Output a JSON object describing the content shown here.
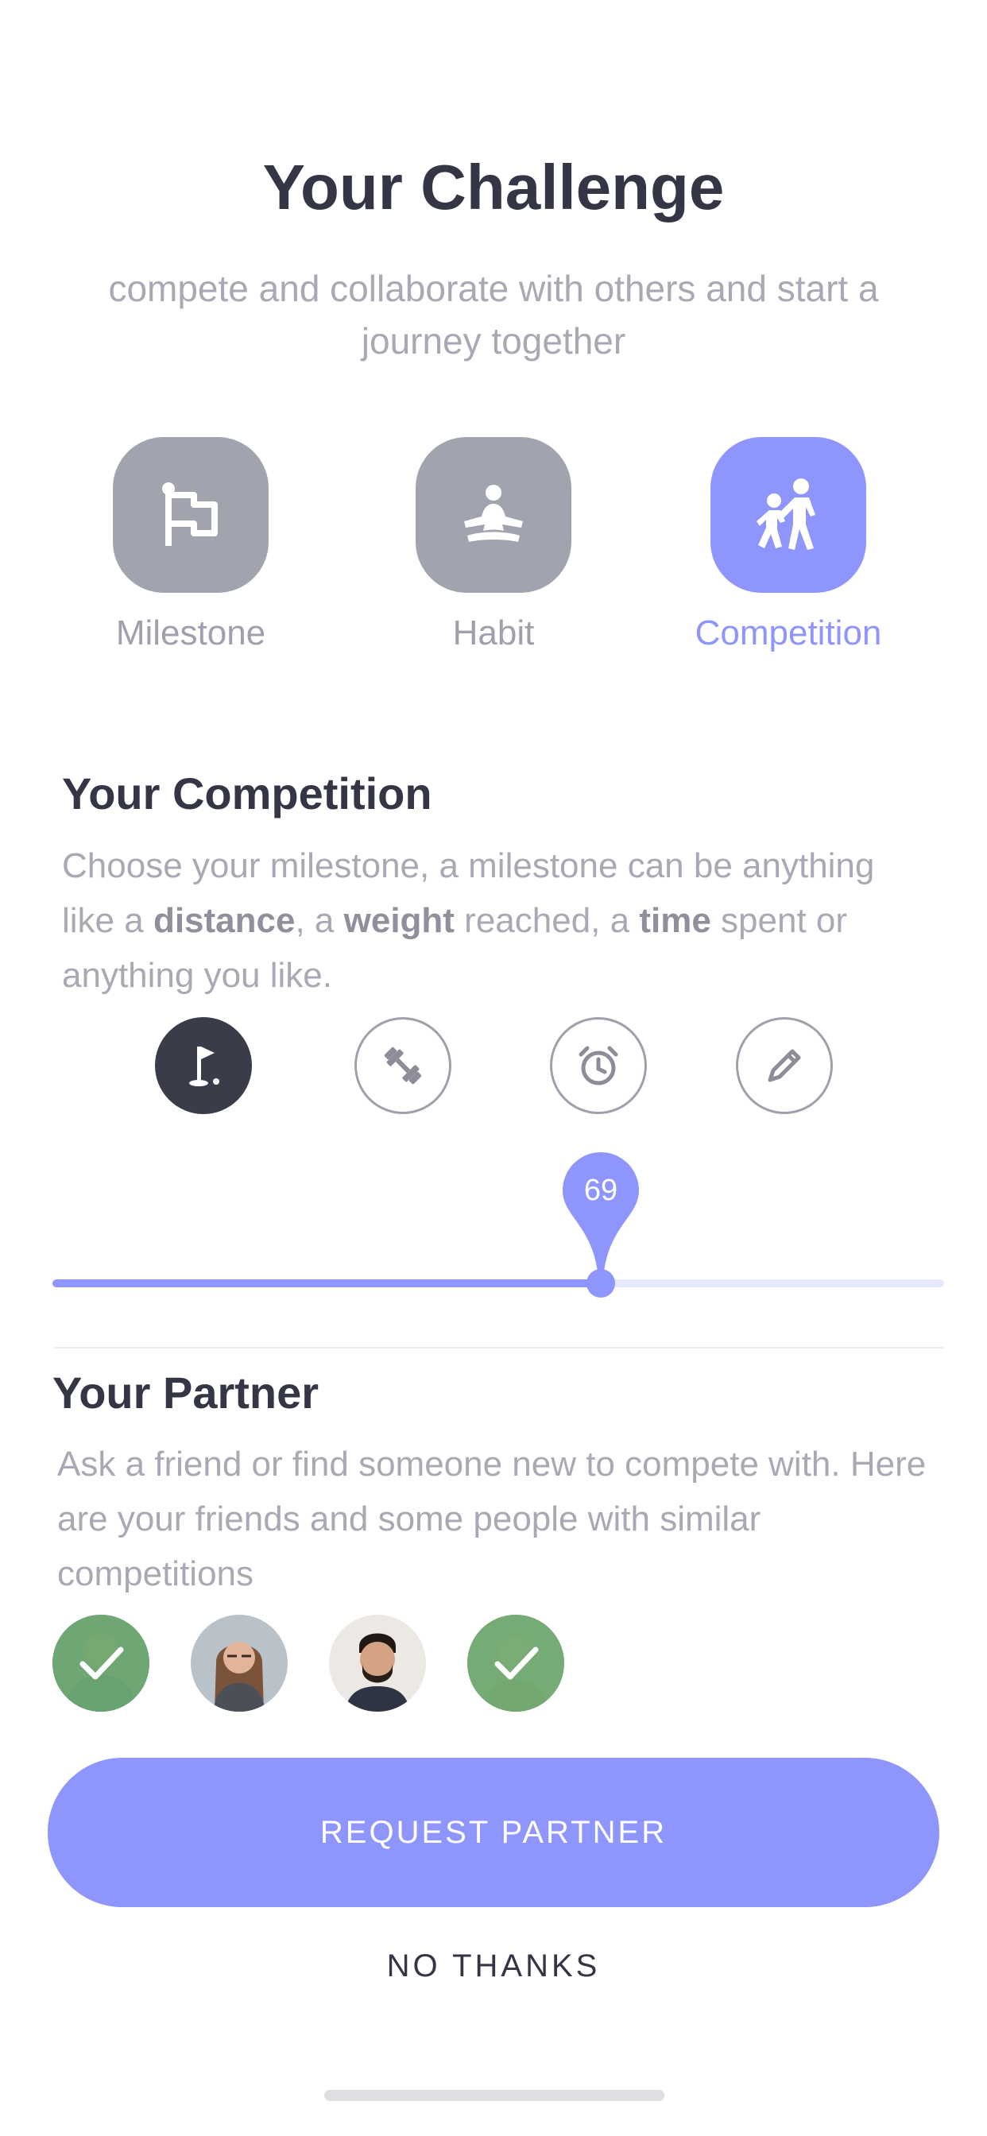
{
  "header": {
    "title": "Your Challenge",
    "subtitle": "compete and collaborate with others and start a journey together"
  },
  "challenge_types": [
    {
      "label": "Milestone",
      "icon": "flag-icon",
      "selected": false
    },
    {
      "label": "Habit",
      "icon": "meditation-icon",
      "selected": false
    },
    {
      "label": "Competition",
      "icon": "competition-people-icon",
      "selected": true
    }
  ],
  "competition": {
    "title": "Your Competition",
    "desc_1": "Choose your milestone, a milestone can be anything like a ",
    "bold_1": "distance",
    "desc_2": ", a ",
    "bold_2": "weight",
    "desc_3": " reached, a ",
    "bold_3": "time",
    "desc_4": " spent or anything you like.",
    "milestone_types": [
      {
        "icon": "golf-flag-icon",
        "selected": true
      },
      {
        "icon": "dumbbell-icon",
        "selected": false
      },
      {
        "icon": "alarm-clock-icon",
        "selected": false
      },
      {
        "icon": "pencil-icon",
        "selected": false
      }
    ],
    "slider": {
      "value": "69",
      "fraction": 0.615
    }
  },
  "partner": {
    "title": "Your Partner",
    "desc": "Ask a friend or find someone new to compete with. Here are your friends and some people with similar competitions",
    "avatars": [
      {
        "name": "partner-avatar-1",
        "selected": true
      },
      {
        "name": "partner-avatar-2",
        "selected": false
      },
      {
        "name": "partner-avatar-3",
        "selected": false
      },
      {
        "name": "partner-avatar-4",
        "selected": true
      }
    ]
  },
  "actions": {
    "primary": "REQUEST PARTNER",
    "secondary": "NO THANKS"
  },
  "colors": {
    "accent": "#8e95fc",
    "dark": "#353645",
    "muted": "#a8a9b5",
    "selected_overlay": "#6aaa6e"
  }
}
